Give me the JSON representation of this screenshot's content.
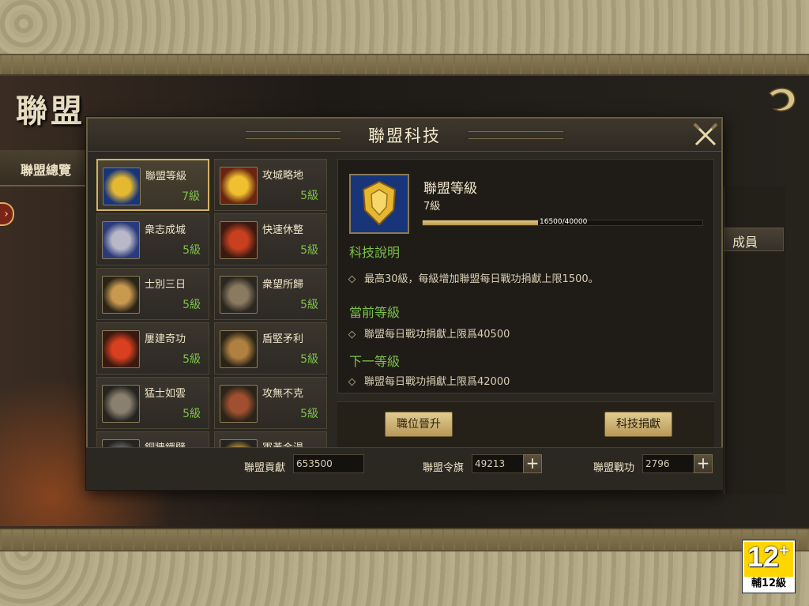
{
  "background": {
    "page_title": "聯盟",
    "side_tab": "聯盟總覽",
    "members_tab": "成員"
  },
  "modal": {
    "title": "聯盟科技"
  },
  "tech_list": [
    {
      "name": "聯盟等級",
      "level": "7級",
      "icon": "shield-icon"
    },
    {
      "name": "攻城略地",
      "level": "5級",
      "icon": "explosion-icon"
    },
    {
      "name": "衆志成城",
      "level": "5級",
      "icon": "tower-icon"
    },
    {
      "name": "快速休整",
      "level": "5級",
      "icon": "troops-icon"
    },
    {
      "name": "士別三日",
      "level": "5級",
      "icon": "scroll-icon"
    },
    {
      "name": "衆望所歸",
      "level": "5級",
      "icon": "warrior-icon"
    },
    {
      "name": "屢建奇功",
      "level": "5級",
      "icon": "banner-icon"
    },
    {
      "name": "盾堅矛利",
      "level": "5級",
      "icon": "shield-spear-icon"
    },
    {
      "name": "猛士如雲",
      "level": "5級",
      "icon": "soldiers-icon"
    },
    {
      "name": "攻無不克",
      "level": "5級",
      "icon": "general-icon"
    },
    {
      "name": "銅牆鐵壁",
      "level": "",
      "icon": "wall-icon"
    },
    {
      "name": "軍黃金湯",
      "level": "",
      "icon": "gold-icon"
    }
  ],
  "detail": {
    "name": "聯盟等級",
    "level": "7級",
    "progress_text": "16500/40000",
    "progress": 0.4125,
    "desc_title": "科技說明",
    "desc_text": "最高30級，每級增加聯盟每日戰功捐獻上限1500。",
    "current_title": "當前等級",
    "current_text": "聯盟每日戰功捐獻上限爲40500",
    "next_title": "下一等級",
    "next_text": "聯盟每日戰功捐獻上限爲42000"
  },
  "actions": {
    "promote_label": "職位晉升",
    "donate_label": "科技捐獻"
  },
  "footer": {
    "contribution_label": "聯盟貢獻",
    "contribution_value": "653500",
    "flag_label": "聯盟令旗",
    "flag_value": "49213",
    "merit_label": "聯盟戰功",
    "merit_value": "2796"
  },
  "rating": {
    "number": "12",
    "plus": "+",
    "label": "輔12級"
  },
  "colors": {
    "accent_green": "#7dc24a",
    "gold": "#d2b265",
    "panel": "#2b2822"
  }
}
